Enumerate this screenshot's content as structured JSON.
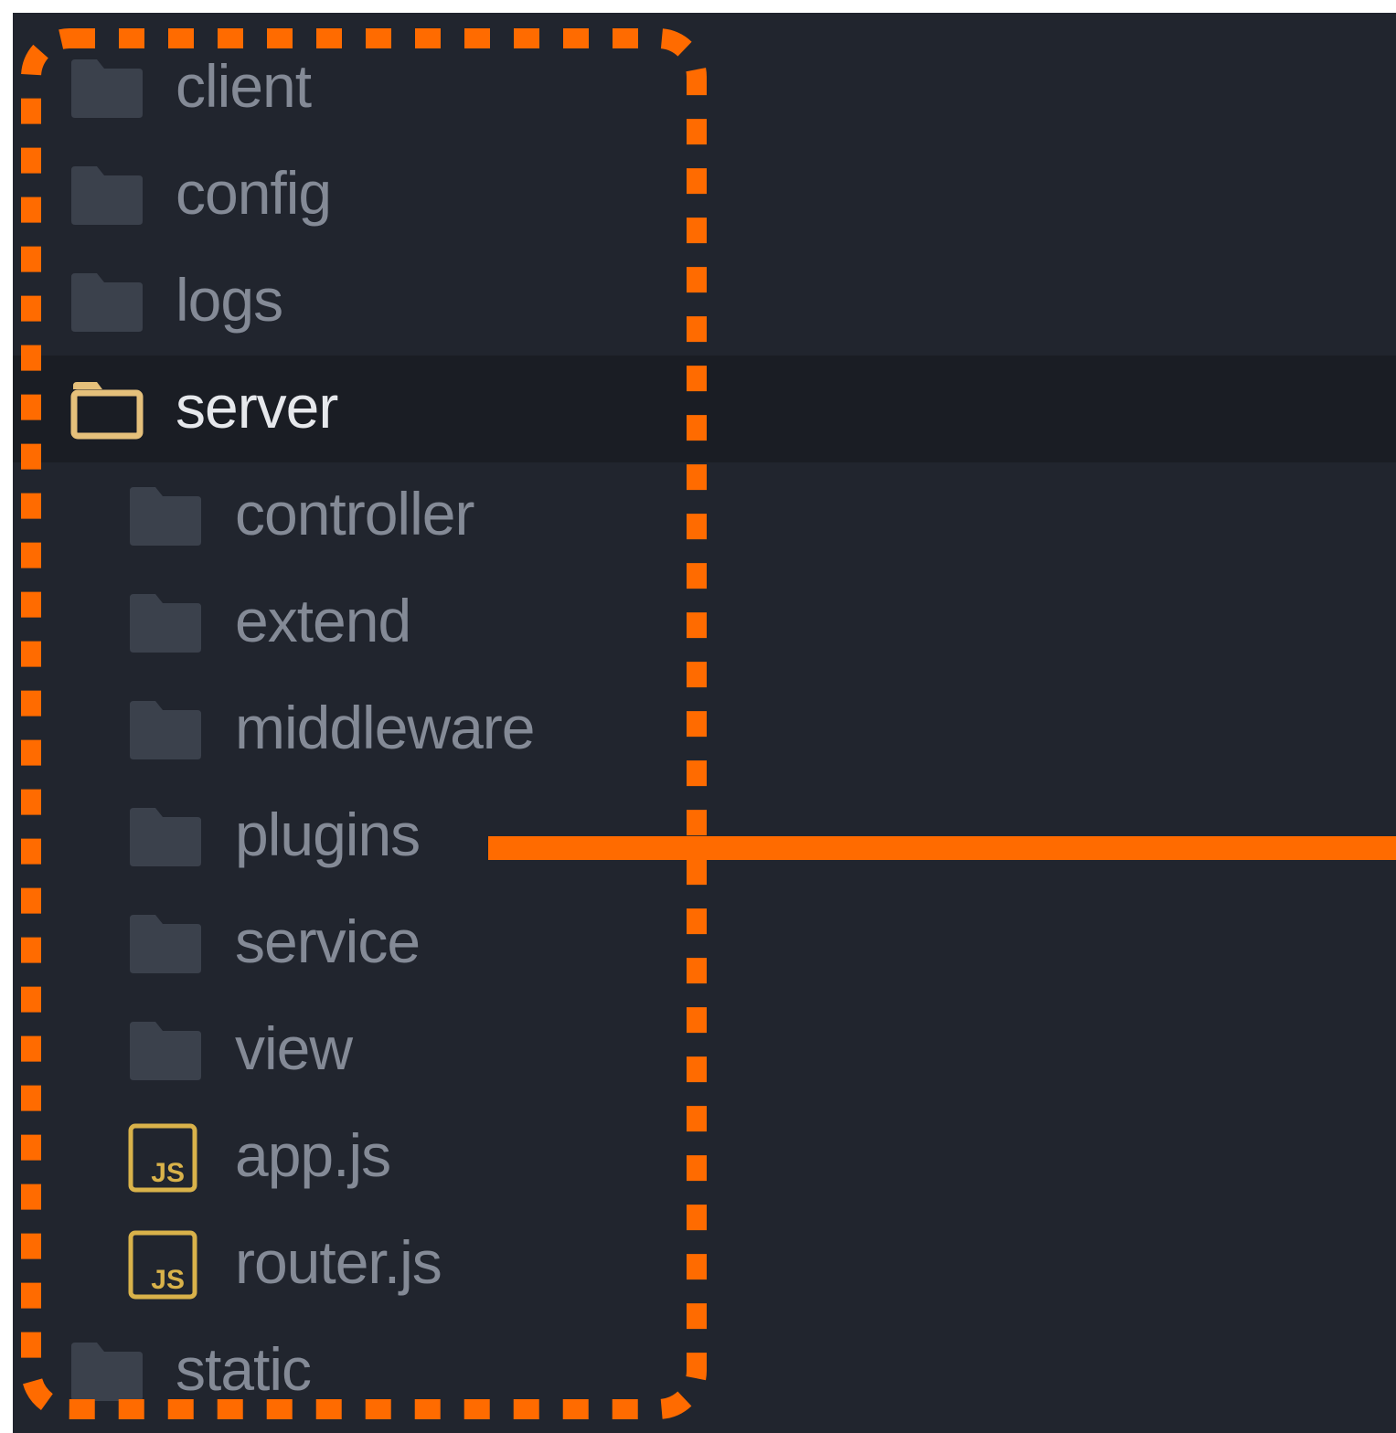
{
  "colors": {
    "panel_background": "#21252e",
    "selected_row_background": "#1a1d24",
    "folder_icon": "#3b414c",
    "open_folder_icon": "#e5c07b",
    "js_icon": "#d9b24a",
    "text_muted": "#848a96",
    "text_selected": "#e6e8ec",
    "annotation": "#ff6b00"
  },
  "file_tree": {
    "items": [
      {
        "label": "client",
        "icon": "folder-icon",
        "depth": 0,
        "selected": false
      },
      {
        "label": "config",
        "icon": "folder-icon",
        "depth": 0,
        "selected": false
      },
      {
        "label": "logs",
        "icon": "folder-icon",
        "depth": 0,
        "selected": false
      },
      {
        "label": "server",
        "icon": "folder-open-icon",
        "depth": 0,
        "selected": true,
        "expanded": true
      },
      {
        "label": "controller",
        "icon": "folder-icon",
        "depth": 1,
        "selected": false
      },
      {
        "label": "extend",
        "icon": "folder-icon",
        "depth": 1,
        "selected": false
      },
      {
        "label": "middleware",
        "icon": "folder-icon",
        "depth": 1,
        "selected": false
      },
      {
        "label": "plugins",
        "icon": "folder-icon",
        "depth": 1,
        "selected": false
      },
      {
        "label": "service",
        "icon": "folder-icon",
        "depth": 1,
        "selected": false
      },
      {
        "label": "view",
        "icon": "folder-icon",
        "depth": 1,
        "selected": false
      },
      {
        "label": "app.js",
        "icon": "js-file-icon",
        "depth": 1,
        "selected": false
      },
      {
        "label": "router.js",
        "icon": "js-file-icon",
        "depth": 1,
        "selected": false
      },
      {
        "label": "static",
        "icon": "folder-icon",
        "depth": 0,
        "selected": false
      }
    ]
  },
  "annotation": {
    "highlight_box": "dotted-rounded-rectangle",
    "pointer_line_target": "plugins"
  }
}
